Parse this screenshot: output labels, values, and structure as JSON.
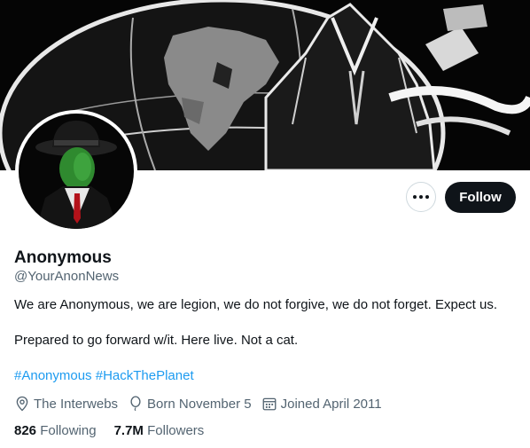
{
  "profile": {
    "name": "Anonymous",
    "handle": "@YourAnonNews",
    "bio_line1": "We are Anonymous, we are legion, we do not forgive, we do not forget. Expect us.",
    "bio_line2": "Prepared to go forward w/it. Here live. Not a cat.",
    "hashtags": [
      "#Anonymous",
      "#HackThePlanet"
    ],
    "location": "The Interwebs",
    "birthday": "Born November 5",
    "joined": "Joined April 2011",
    "following_count": "826",
    "following_label": "Following",
    "followers_count": "7.7M",
    "followers_label": "Followers"
  },
  "actions": {
    "follow_label": "Follow",
    "more_icon": "more-icon"
  },
  "icons": {
    "location": "location-pin-icon",
    "birthday": "balloon-icon",
    "joined": "calendar-icon"
  },
  "colors": {
    "accent": "#1d9bf0",
    "text": "#0f1419",
    "muted": "#536471",
    "follow_bg": "#0f1419"
  }
}
